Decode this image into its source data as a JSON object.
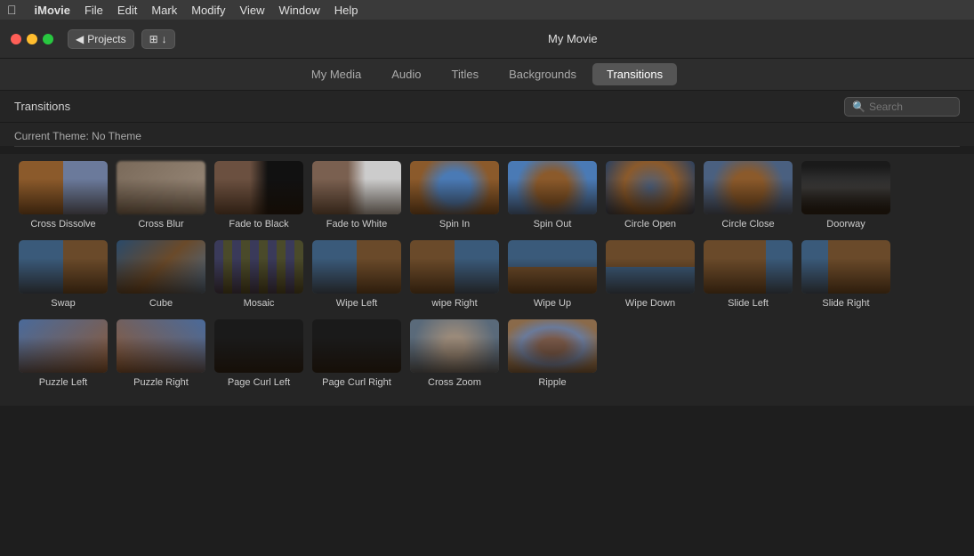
{
  "menubar": {
    "apple": "⌘",
    "app": "iMovie",
    "items": [
      "File",
      "Edit",
      "Mark",
      "Modify",
      "View",
      "Window",
      "Help"
    ]
  },
  "titlebar": {
    "projects_label": "◀ Projects",
    "title": "My Movie"
  },
  "tabs": [
    {
      "id": "my-media",
      "label": "My Media",
      "active": false
    },
    {
      "id": "audio",
      "label": "Audio",
      "active": false
    },
    {
      "id": "titles",
      "label": "Titles",
      "active": false
    },
    {
      "id": "backgrounds",
      "label": "Backgrounds",
      "active": false
    },
    {
      "id": "transitions",
      "label": "Transitions",
      "active": true
    }
  ],
  "content": {
    "title": "Transitions",
    "theme_label": "Current Theme: No Theme",
    "search_placeholder": "Search"
  },
  "transitions": [
    {
      "id": "cross-dissolve",
      "label": "Cross Dissolve",
      "thumb": "cross-dissolve"
    },
    {
      "id": "cross-blur",
      "label": "Cross Blur",
      "thumb": "cross-blur"
    },
    {
      "id": "fade-to-black",
      "label": "Fade to Black",
      "thumb": "fade-black"
    },
    {
      "id": "fade-to-white",
      "label": "Fade to White",
      "thumb": "fade-white"
    },
    {
      "id": "spin-in",
      "label": "Spin In",
      "thumb": "spin-in"
    },
    {
      "id": "spin-out",
      "label": "Spin Out",
      "thumb": "spin-out"
    },
    {
      "id": "circle-open",
      "label": "Circle Open",
      "thumb": "circle-open"
    },
    {
      "id": "circle-close",
      "label": "Circle Close",
      "thumb": "circle-close"
    },
    {
      "id": "doorway",
      "label": "Doorway",
      "thumb": "doorway"
    },
    {
      "id": "swap",
      "label": "Swap",
      "thumb": "swap"
    },
    {
      "id": "cube",
      "label": "Cube",
      "thumb": "cube"
    },
    {
      "id": "mosaic",
      "label": "Mosaic",
      "thumb": "mosaic"
    },
    {
      "id": "wipe-left",
      "label": "Wipe Left",
      "thumb": "wipe-left"
    },
    {
      "id": "wipe-right",
      "label": "wipe Right",
      "thumb": "wipe-right"
    },
    {
      "id": "wipe-up",
      "label": "Wipe Up",
      "thumb": "wipe-up"
    },
    {
      "id": "wipe-down",
      "label": "Wipe Down",
      "thumb": "wipe-down"
    },
    {
      "id": "slide-left",
      "label": "Slide Left",
      "thumb": "slide-left"
    },
    {
      "id": "slide-right",
      "label": "Slide Right",
      "thumb": "slide-right"
    },
    {
      "id": "puzzle-left",
      "label": "Puzzle Left",
      "thumb": "puzzle-left"
    },
    {
      "id": "puzzle-right",
      "label": "Puzzle Right",
      "thumb": "puzzle-right"
    },
    {
      "id": "page-curl-left",
      "label": "Page Curl Left",
      "thumb": "page-curl-left"
    },
    {
      "id": "page-curl-right",
      "label": "Page Curl Right",
      "thumb": "page-curl-right"
    },
    {
      "id": "cross-zoom",
      "label": "Cross Zoom",
      "thumb": "cross-zoom"
    },
    {
      "id": "ripple",
      "label": "Ripple",
      "thumb": "ripple"
    }
  ]
}
